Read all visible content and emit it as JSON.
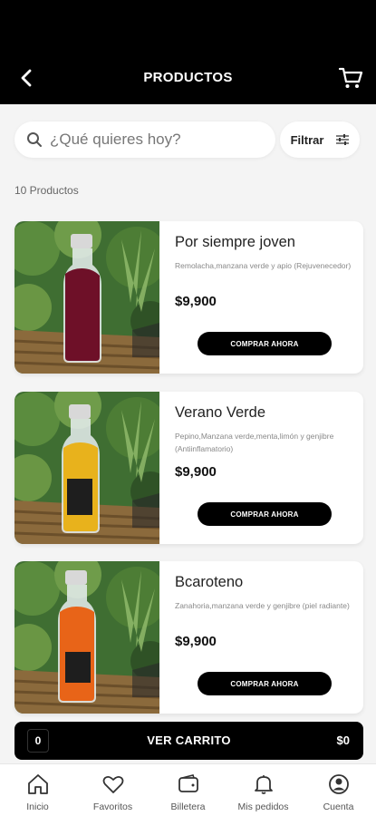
{
  "header": {
    "title": "PRODUCTOS",
    "back_icon": "arrow-left-icon",
    "cart_icon": "cart-icon"
  },
  "search": {
    "placeholder": "¿Qué quieres hoy?"
  },
  "filter": {
    "label": "Filtrar"
  },
  "results": {
    "count_label": "10 Productos"
  },
  "products": [
    {
      "name": "Por siempre joven",
      "description": "Remolacha,manzana verde y apio (Rejuvenecedor)",
      "price": "$9,900",
      "button": "COMPRAR AHORA",
      "juice_color": "#6e1028"
    },
    {
      "name": "Verano Verde",
      "description": "Pepino,Manzana verde,menta,limón y genjibre (Antiinflamatorio)",
      "price": "$9,900",
      "button": "COMPRAR AHORA",
      "juice_color": "#e8b21c"
    },
    {
      "name": "Bcaroteno",
      "description": "Zanahoria,manzana verde y genjibre (piel radiante)",
      "price": "$9,900",
      "button": "COMPRAR AHORA",
      "juice_color": "#e86418"
    }
  ],
  "cart_bar": {
    "quantity": "0",
    "label": "VER CARRITO",
    "total": "$0"
  },
  "nav": [
    {
      "label": "Inicio",
      "icon": "home-icon"
    },
    {
      "label": "Favoritos",
      "icon": "heart-icon"
    },
    {
      "label": "Billetera",
      "icon": "wallet-icon"
    },
    {
      "label": "Mis pedidos",
      "icon": "bell-icon"
    },
    {
      "label": "Cuenta",
      "icon": "account-icon"
    }
  ],
  "colors": {
    "header_bg": "#000000",
    "page_bg": "#f4f4f4",
    "accent": "#000000"
  }
}
